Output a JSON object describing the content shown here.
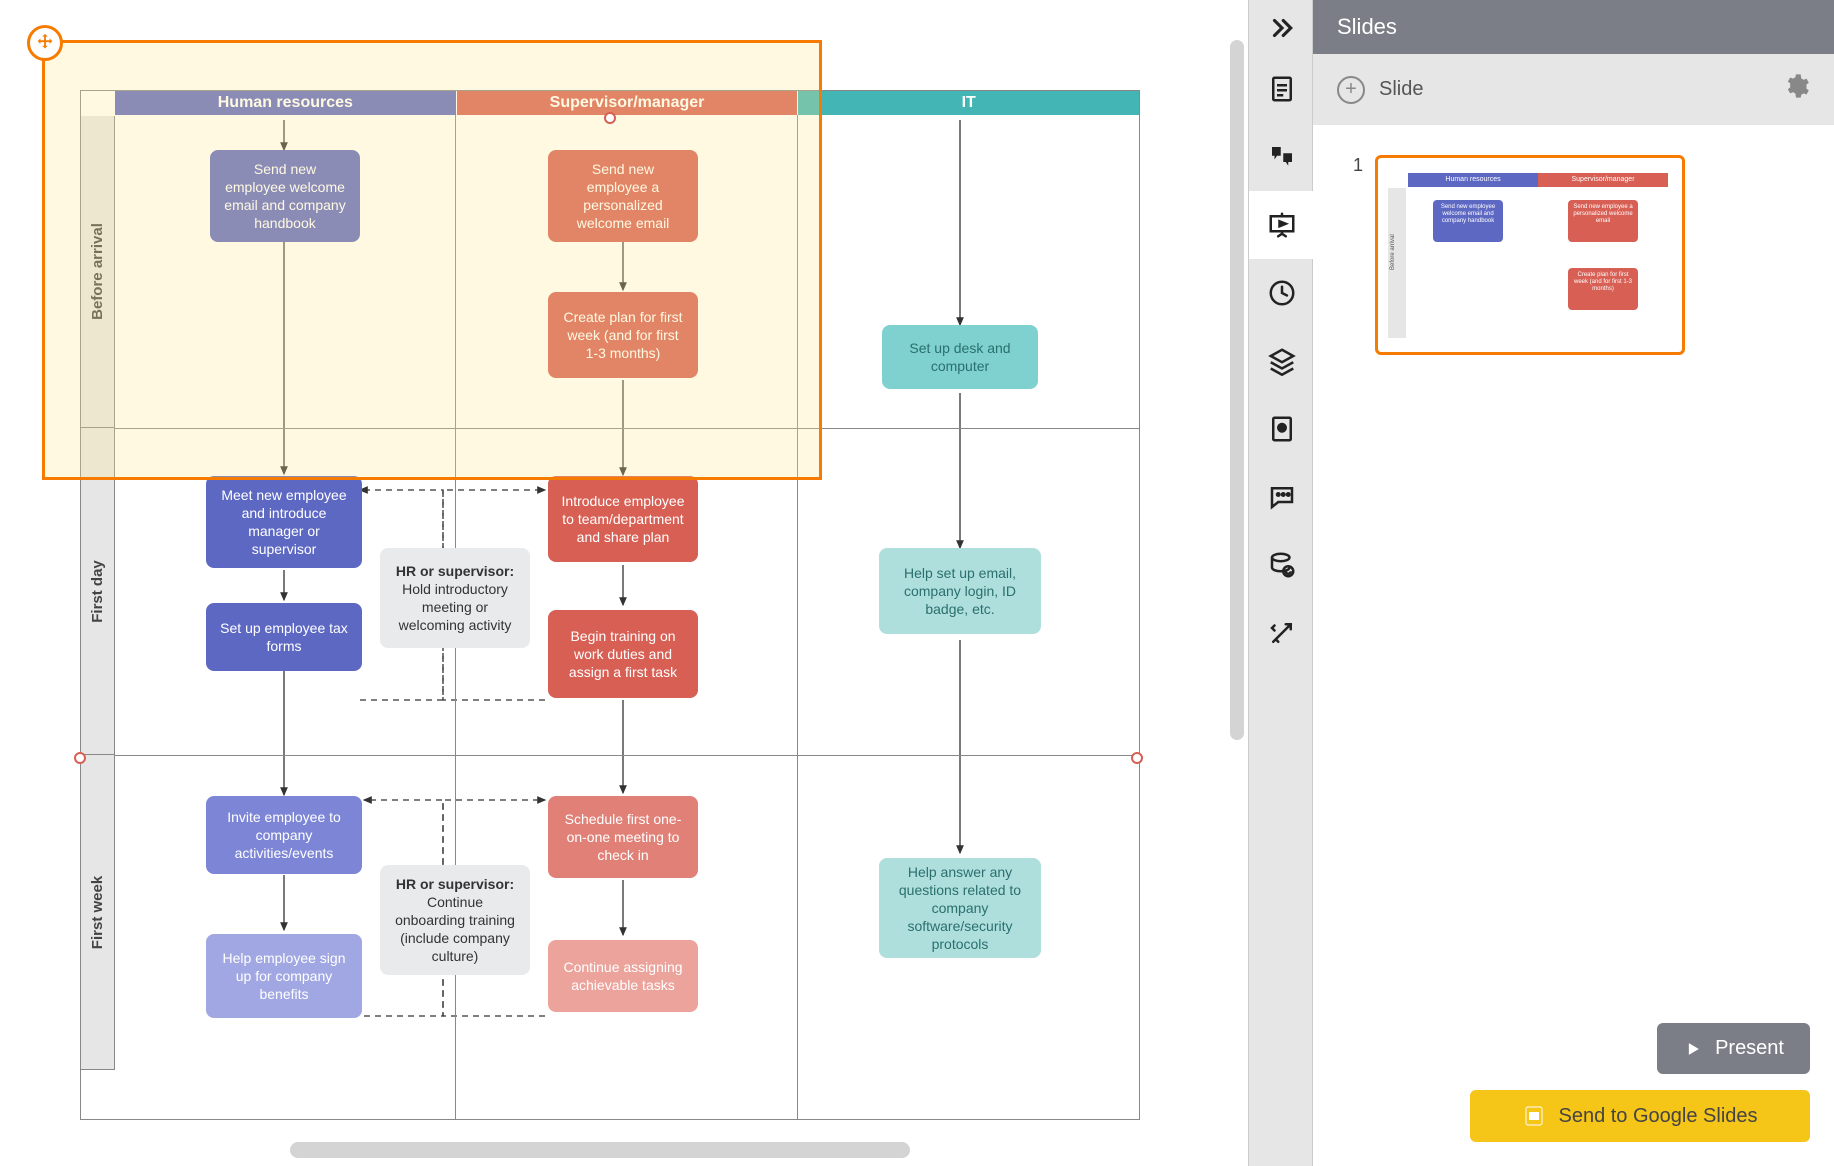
{
  "panel": {
    "title": "Slides",
    "add_label": "Slide",
    "slide_num": "1",
    "present_label": "Present",
    "google_label": "Send to Google Slides"
  },
  "columns": {
    "hr": "Human resources",
    "sv": "Supervisor/manager",
    "it": "IT"
  },
  "rows": {
    "before": "Before arrival",
    "firstday": "First day",
    "firstweek": "First week"
  },
  "nodes": {
    "hr_welcome": "Send new employee welcome email and company handbook",
    "sv_welcome": "Send new employee a personalized welcome email",
    "sv_plan": "Create plan for first week (and for first 1-3 months)",
    "it_desk": "Set up desk and computer",
    "hr_meet": "Meet new employee and introduce manager or supervisor",
    "hr_meeting_bold": "HR or supervisor:",
    "hr_meeting_rest": " Hold introductory meeting or welcoming activity",
    "sv_intro": "Introduce employee to team/department and share plan",
    "hr_tax": "Set up employee tax forms",
    "sv_train": "Begin training on work duties and assign a first task",
    "it_help": "Help set up email, company login, ID badge, etc.",
    "hr_invite": "Invite employee to company activities/events",
    "hr_onboard_bold": "HR or supervisor:",
    "hr_onboard_rest": " Continue onboarding training (include company culture)",
    "sv_sched": "Schedule first one-on-one meeting to check in",
    "hr_benefits": "Help employee sign up for company benefits",
    "sv_assign": "Continue assigning achievable tasks",
    "it_answer": "Help answer any questions related to company software/security protocols"
  },
  "thumb": {
    "hr": "Human resources",
    "sv": "Supervisor/manager",
    "n1": "Send new employee welcome email and company handbook",
    "n2": "Send new employee a personalized welcome email",
    "n3": "Create plan for first week (and for first 1-3 months)",
    "side": "Before arrival"
  }
}
